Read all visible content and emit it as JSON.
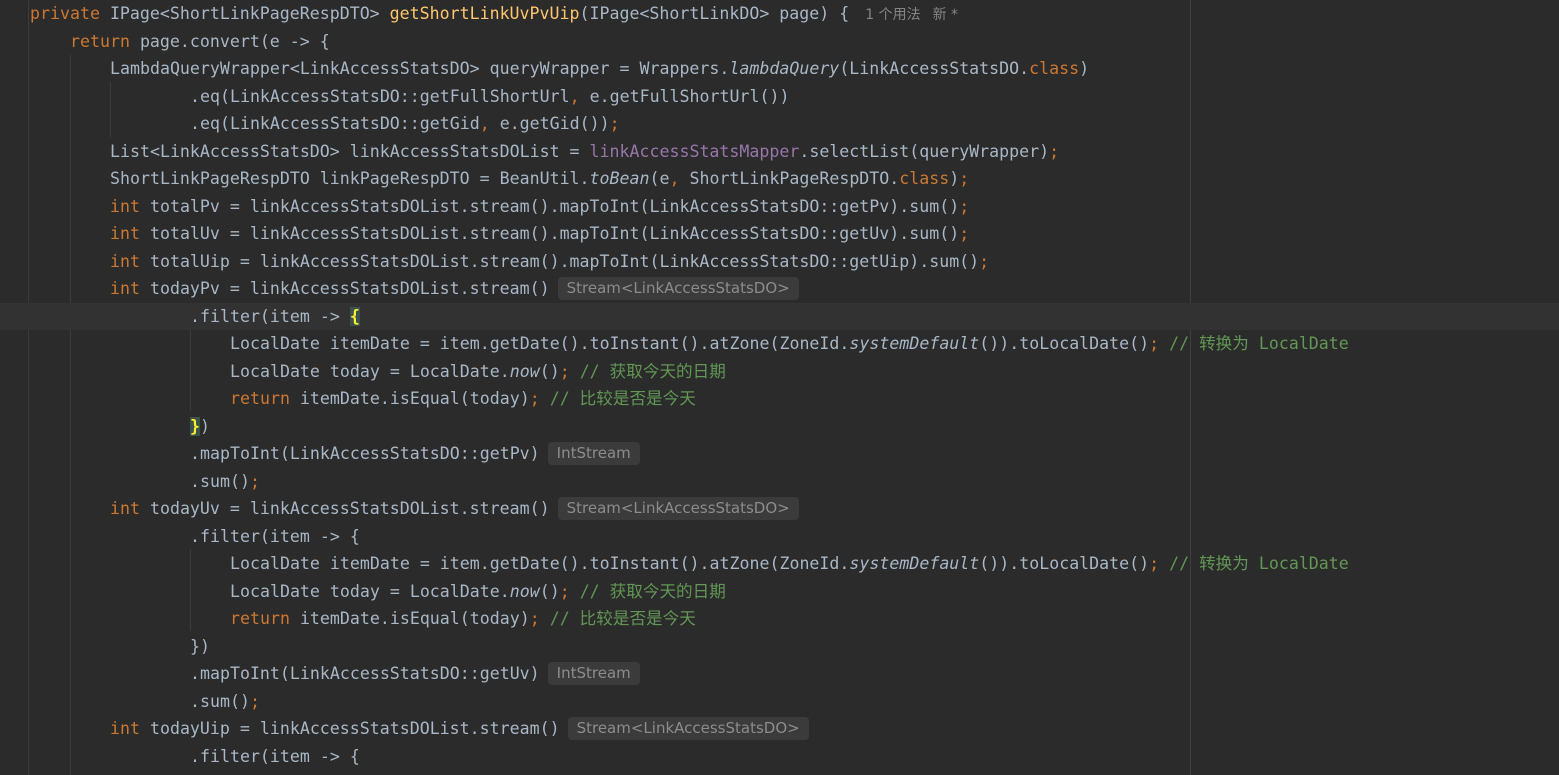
{
  "editor": {
    "lines": [
      {
        "indent": 0,
        "tokens": [
          {
            "t": "private ",
            "c": "kw"
          },
          {
            "t": "IPage<ShortLinkPageRespDTO> "
          },
          {
            "t": "getShortLinkUvPvUip",
            "c": "fn"
          },
          {
            "t": "(IPage<ShortLinkDO> page) {"
          }
        ],
        "usage": [
          "1 个用法",
          "新 *"
        ]
      },
      {
        "indent": 1,
        "tokens": [
          {
            "t": "return ",
            "c": "kw"
          },
          {
            "t": "page.convert(e -> {"
          }
        ]
      },
      {
        "indent": 2,
        "tokens": [
          {
            "t": "LambdaQueryWrapper<LinkAccessStatsDO> queryWrapper = Wrappers."
          },
          {
            "t": "lambdaQuery",
            "c": "it"
          },
          {
            "t": "(LinkAccessStatsDO."
          },
          {
            "t": "class",
            "c": "kw"
          },
          {
            "t": ")"
          }
        ]
      },
      {
        "indent": 4,
        "tokens": [
          {
            "t": ".eq(LinkAccessStatsDO::getFullShortUrl"
          },
          {
            "t": ", ",
            "c": "kw"
          },
          {
            "t": "e.getFullShortUrl())"
          }
        ]
      },
      {
        "indent": 4,
        "tokens": [
          {
            "t": ".eq(LinkAccessStatsDO::getGid"
          },
          {
            "t": ", ",
            "c": "kw"
          },
          {
            "t": "e.getGid())"
          },
          {
            "t": ";",
            "c": "kw"
          }
        ]
      },
      {
        "indent": 2,
        "tokens": [
          {
            "t": "List<LinkAccessStatsDO> linkAccessStatsDOList = "
          },
          {
            "t": "linkAccessStatsMapper",
            "c": "purple"
          },
          {
            "t": ".selectList(queryWrapper)"
          },
          {
            "t": ";",
            "c": "kw"
          }
        ]
      },
      {
        "indent": 2,
        "tokens": [
          {
            "t": "ShortLinkPageRespDTO linkPageRespDTO = BeanUtil."
          },
          {
            "t": "toBean",
            "c": "it"
          },
          {
            "t": "(e"
          },
          {
            "t": ", ",
            "c": "kw"
          },
          {
            "t": "ShortLinkPageRespDTO."
          },
          {
            "t": "class",
            "c": "kw"
          },
          {
            "t": ")"
          },
          {
            "t": ";",
            "c": "kw"
          }
        ]
      },
      {
        "indent": 2,
        "tokens": [
          {
            "t": "int ",
            "c": "kw"
          },
          {
            "t": "totalPv = linkAccessStatsDOList.stream().mapToInt(LinkAccessStatsDO::getPv).sum()"
          },
          {
            "t": ";",
            "c": "kw"
          }
        ]
      },
      {
        "indent": 2,
        "tokens": [
          {
            "t": "int ",
            "c": "kw"
          },
          {
            "t": "totalUv = linkAccessStatsDOList.stream().mapToInt(LinkAccessStatsDO::getUv).sum()"
          },
          {
            "t": ";",
            "c": "kw"
          }
        ]
      },
      {
        "indent": 2,
        "tokens": [
          {
            "t": "int ",
            "c": "kw"
          },
          {
            "t": "totalUip = linkAccessStatsDOList.stream().mapToInt(LinkAccessStatsDO::getUip).sum()"
          },
          {
            "t": ";",
            "c": "kw"
          }
        ]
      },
      {
        "indent": 2,
        "tokens": [
          {
            "t": "int ",
            "c": "kw"
          },
          {
            "t": "todayPv = linkAccessStatsDOList.stream()"
          }
        ],
        "hint": "Stream<LinkAccessStatsDO>"
      },
      {
        "indent": 4,
        "current": true,
        "tokens": [
          {
            "t": ".filter(item -> "
          },
          {
            "t": "{",
            "c": "brace-hl"
          }
        ]
      },
      {
        "indent": 5,
        "tokens": [
          {
            "t": "LocalDate itemDate = item.getDate().toInstant().atZone(ZoneId."
          },
          {
            "t": "systemDefault",
            "c": "it"
          },
          {
            "t": "()).toLocalDate()"
          },
          {
            "t": "; ",
            "c": "kw"
          },
          {
            "t": "// 转换为 LocalDate",
            "c": "cmt"
          }
        ]
      },
      {
        "indent": 5,
        "tokens": [
          {
            "t": "LocalDate today = LocalDate."
          },
          {
            "t": "now",
            "c": "it"
          },
          {
            "t": "()"
          },
          {
            "t": "; ",
            "c": "kw"
          },
          {
            "t": "// 获取今天的日期",
            "c": "cmt"
          }
        ]
      },
      {
        "indent": 5,
        "tokens": [
          {
            "t": "return ",
            "c": "kw"
          },
          {
            "t": "itemDate.isEqual(today)"
          },
          {
            "t": "; ",
            "c": "kw"
          },
          {
            "t": "// 比较是否是今天",
            "c": "cmt"
          }
        ]
      },
      {
        "indent": 4,
        "tokens": [
          {
            "t": "}",
            "c": "brace-hl"
          },
          {
            "t": ")"
          }
        ]
      },
      {
        "indent": 4,
        "tokens": [
          {
            "t": ".mapToInt(LinkAccessStatsDO::getPv)"
          }
        ],
        "hint": "IntStream"
      },
      {
        "indent": 4,
        "tokens": [
          {
            "t": ".sum()"
          },
          {
            "t": ";",
            "c": "kw"
          }
        ]
      },
      {
        "indent": 2,
        "tokens": [
          {
            "t": "int ",
            "c": "kw"
          },
          {
            "t": "todayUv = linkAccessStatsDOList.stream()"
          }
        ],
        "hint": "Stream<LinkAccessStatsDO>"
      },
      {
        "indent": 4,
        "tokens": [
          {
            "t": ".filter(item -> {"
          }
        ]
      },
      {
        "indent": 5,
        "tokens": [
          {
            "t": "LocalDate itemDate = item.getDate().toInstant().atZone(ZoneId."
          },
          {
            "t": "systemDefault",
            "c": "it"
          },
          {
            "t": "()).toLocalDate()"
          },
          {
            "t": "; ",
            "c": "kw"
          },
          {
            "t": "// 转换为 LocalDate",
            "c": "cmt"
          }
        ]
      },
      {
        "indent": 5,
        "tokens": [
          {
            "t": "LocalDate today = LocalDate."
          },
          {
            "t": "now",
            "c": "it"
          },
          {
            "t": "()"
          },
          {
            "t": "; ",
            "c": "kw"
          },
          {
            "t": "// 获取今天的日期",
            "c": "cmt"
          }
        ]
      },
      {
        "indent": 5,
        "tokens": [
          {
            "t": "return ",
            "c": "kw"
          },
          {
            "t": "itemDate.isEqual(today)"
          },
          {
            "t": "; ",
            "c": "kw"
          },
          {
            "t": "// 比较是否是今天",
            "c": "cmt"
          }
        ]
      },
      {
        "indent": 4,
        "tokens": [
          {
            "t": "})"
          }
        ]
      },
      {
        "indent": 4,
        "tokens": [
          {
            "t": ".mapToInt(LinkAccessStatsDO::getUv)"
          }
        ],
        "hint": "IntStream"
      },
      {
        "indent": 4,
        "tokens": [
          {
            "t": ".sum()"
          },
          {
            "t": ";",
            "c": "kw"
          }
        ]
      },
      {
        "indent": 2,
        "tokens": [
          {
            "t": "int ",
            "c": "kw"
          },
          {
            "t": "todayUip = linkAccessStatsDOList.stream()"
          }
        ],
        "hint": "Stream<LinkAccessStatsDO>"
      },
      {
        "indent": 4,
        "tokens": [
          {
            "t": ".filter(item -> {"
          }
        ]
      }
    ]
  }
}
